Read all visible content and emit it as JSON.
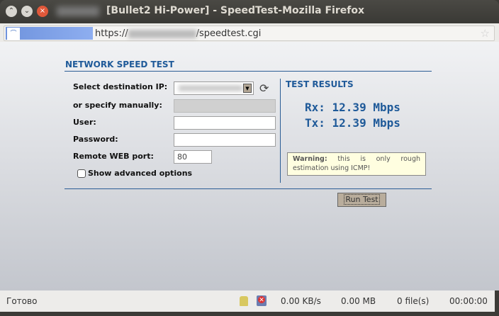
{
  "window": {
    "title": "[Bullet2 Hi-Power] - SpeedTest-Mozilla Firefox"
  },
  "urlbar": {
    "prefix": "https://",
    "suffix": "/speedtest.cgi"
  },
  "page": {
    "heading": "NETWORK SPEED TEST",
    "labels": {
      "dest_ip": "Select destination IP:",
      "manual": "or specify manually:",
      "user": "User:",
      "password": "Password:",
      "port": "Remote WEB port:",
      "advanced": "Show advanced options"
    },
    "port_value": "80",
    "results": {
      "heading": "TEST RESULTS",
      "rx": "Rx: 12.39 Mbps",
      "tx": "Tx: 12.39 Mbps"
    },
    "warning": {
      "label": "Warning:",
      "text": " this is only rough estimation using ICMP!"
    },
    "run_button": "Run Test"
  },
  "statusbar": {
    "status": "Готово",
    "speed": "0.00 KB/s",
    "size": "0.00 MB",
    "files": "0 file(s)",
    "time": "00:00:00"
  }
}
